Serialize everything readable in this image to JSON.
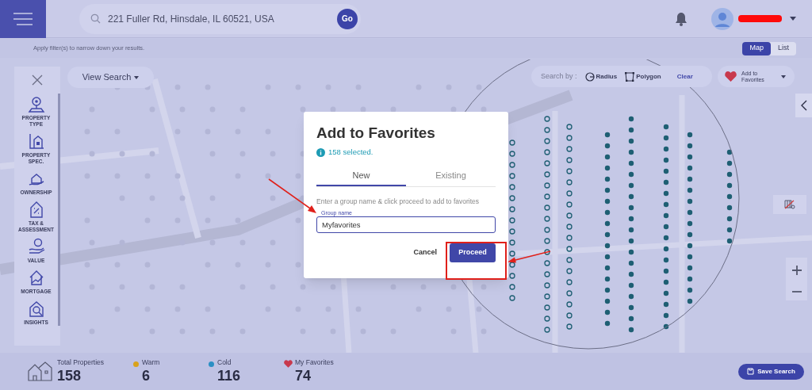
{
  "header": {
    "address": "221 Fuller Rd, Hinsdale, IL 60521, USA",
    "go_button": "Go"
  },
  "filter_hint": "Apply filter(s) to narrow down your results.",
  "view_toggle": [
    {
      "label": "Map",
      "selected": true
    },
    {
      "label": "List",
      "selected": false
    }
  ],
  "view_search": "View Search",
  "sidebar": {
    "items": [
      {
        "label": "PROPERTY TYPE"
      },
      {
        "label": "PROPERTY SPEC."
      },
      {
        "label": "OWNERSHIP"
      },
      {
        "label": "TAX & ASSESSMENT"
      },
      {
        "label": "VALUE"
      },
      {
        "label": "MORTGAGE"
      },
      {
        "label": "INSIGHTS"
      }
    ]
  },
  "search_by": {
    "label": "Search by :",
    "tools": [
      "Radius",
      "Polygon"
    ],
    "clear": "Clear"
  },
  "add_to_favorites": "Add to Favorites",
  "modal": {
    "title": "Add to Favorites",
    "selected_info": "158 selected.",
    "tabs": [
      {
        "label": "New",
        "selected": true
      },
      {
        "label": "Existing",
        "selected": false
      }
    ],
    "instruction": "Enter a group name & click proceed to add to favorites",
    "field": {
      "label": "Group name",
      "value": "Myfavorites"
    },
    "cancel": "Cancel",
    "proceed": "Proceed"
  },
  "stats": [
    {
      "kind": "total",
      "label": "Total Properties",
      "value": "158"
    },
    {
      "kind": "dot",
      "label": "Warm",
      "value": "6",
      "color": "#d9a21b"
    },
    {
      "kind": "dot",
      "label": "Cold",
      "value": "116",
      "color": "#2b8fc4"
    },
    {
      "kind": "heart",
      "label": "My Favorites",
      "value": "74"
    }
  ],
  "save_search": "Save Search"
}
